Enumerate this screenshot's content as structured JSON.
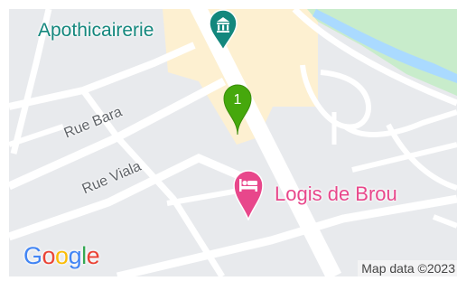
{
  "map": {
    "poi": {
      "name": "Apothicairerie",
      "icon": "museum-icon",
      "color": "#13877d"
    },
    "marker": {
      "label": "1",
      "color": "#46a80c"
    },
    "hotel": {
      "name": "Logis de Brou",
      "icon": "hotel-bed-icon",
      "color": "#e8478b"
    },
    "streets": [
      {
        "name": "Rue Bara"
      },
      {
        "name": "Rue Viala"
      }
    ],
    "logo": "Google",
    "attribution": "Map data ©2023",
    "colors": {
      "land": "#e8eaed",
      "road": "#ffffff",
      "building_area": "#fdf0d1",
      "park": "#c8eccb",
      "water": "#aadaff",
      "text": "#5f6368"
    }
  }
}
